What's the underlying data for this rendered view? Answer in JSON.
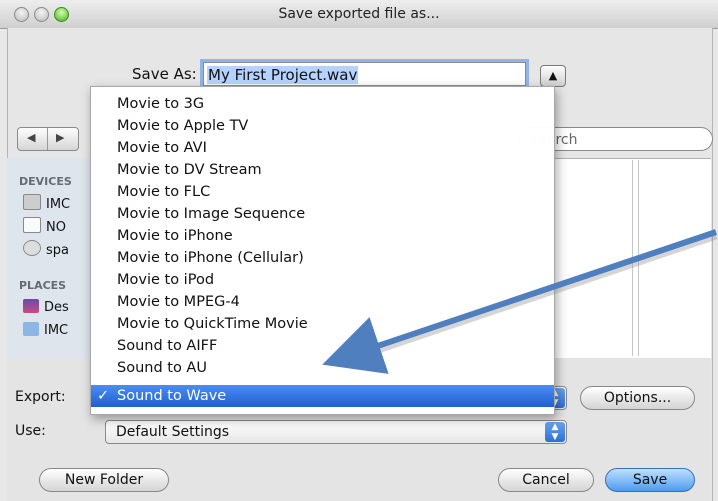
{
  "window": {
    "title": "Save exported file as..."
  },
  "save_as": {
    "label": "Save As:",
    "value": "My First Project.wav",
    "disclosure_icon": "▲"
  },
  "navigation": {
    "back_icon": "◀",
    "forward_icon": "▶"
  },
  "search": {
    "placeholder": "search"
  },
  "sidebar": {
    "devices_header": "DEVICES",
    "places_header": "PLACES",
    "items": [
      {
        "label": "IMC",
        "icon": "disk-icon"
      },
      {
        "label": "NO",
        "icon": "drive-icon"
      },
      {
        "label": "spa",
        "icon": "disc-icon"
      },
      {
        "label": "Des",
        "icon": "desktop-icon"
      },
      {
        "label": "IMC",
        "icon": "folder-icon"
      }
    ]
  },
  "export": {
    "label": "Export:",
    "selected": "Sound to Wave",
    "options_button": "Options...",
    "menu_items": [
      "Movie to 3G",
      "Movie to Apple TV",
      "Movie to AVI",
      "Movie to DV Stream",
      "Movie to FLC",
      "Movie to Image Sequence",
      "Movie to iPhone",
      "Movie to iPhone (Cellular)",
      "Movie to iPod",
      "Movie to MPEG-4",
      "Movie to QuickTime Movie",
      "Sound to AIFF",
      "Sound to AU",
      "Sound to Wave"
    ],
    "check_mark": "✓"
  },
  "use": {
    "label": "Use:",
    "value": "Default Settings"
  },
  "buttons": {
    "new_folder": "New Folder",
    "cancel": "Cancel",
    "save": "Save"
  },
  "colors": {
    "selection": "#2b6fde",
    "arrow": "#4f7fbf",
    "default_button": "#5aa2f0"
  }
}
